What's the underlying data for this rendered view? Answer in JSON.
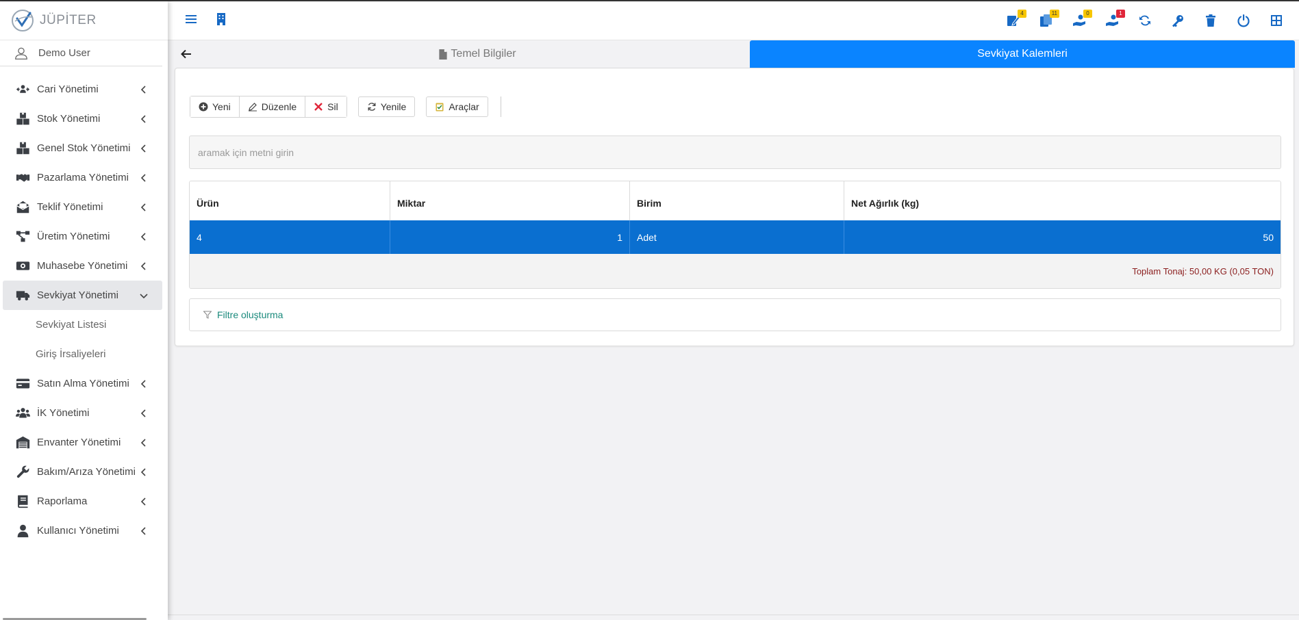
{
  "brand": {
    "name": "JÜPİTER"
  },
  "user": {
    "name": "Demo User"
  },
  "sidebar": {
    "items": [
      {
        "label": "Cari Yönetimi",
        "icon": "user-arrows-icon"
      },
      {
        "label": "Stok Yönetimi",
        "icon": "boxes-icon"
      },
      {
        "label": "Genel Stok Yönetimi",
        "icon": "boxes-icon"
      },
      {
        "label": "Pazarlama Yönetimi",
        "icon": "handshake-icon"
      },
      {
        "label": "Teklif Yönetimi",
        "icon": "envelope-open-icon"
      },
      {
        "label": "Üretim Yönetimi",
        "icon": "diagram-icon"
      },
      {
        "label": "Muhasebe Yönetimi",
        "icon": "money-bill-icon"
      },
      {
        "label": "Sevkiyat Yönetimi",
        "icon": "truck-icon",
        "expanded": true
      },
      {
        "label": "Satın Alma Yönetimi",
        "icon": "credit-card-icon"
      },
      {
        "label": "İK Yönetimi",
        "icon": "users-icon"
      },
      {
        "label": "Envanter Yönetimi",
        "icon": "warehouse-icon"
      },
      {
        "label": "Bakım/Arıza Yönetimi",
        "icon": "wrench-icon"
      },
      {
        "label": "Raporlama",
        "icon": "book-icon"
      },
      {
        "label": "Kullanıcı Yönetimi",
        "icon": "user-icon"
      }
    ],
    "sub_items": [
      {
        "label": "Sevkiyat Listesi"
      },
      {
        "label": "Giriş İrsaliyeleri"
      }
    ]
  },
  "header": {
    "badges": {
      "tasks": "4",
      "notes": "11",
      "hand1": "0",
      "hand2": "1"
    }
  },
  "tabs": [
    {
      "label": "Temel Bilgiler",
      "active": false
    },
    {
      "label": "Sevkiyat Kalemleri",
      "active": true
    }
  ],
  "toolbar": {
    "new_label": "Yeni",
    "edit_label": "Düzenle",
    "delete_label": "Sil",
    "refresh_label": "Yenile",
    "tools_label": "Araçlar"
  },
  "search": {
    "placeholder": "aramak için metni girin"
  },
  "grid": {
    "columns": [
      "Ürün",
      "Miktar",
      "Birim",
      "Net Ağırlık (kg)"
    ],
    "rows": [
      {
        "urun": "4",
        "miktar": "1",
        "birim": "Adet",
        "net_agirlik": "50"
      }
    ],
    "total_label": "Toplam Tonaj: 50,00 KG (0,05 TON)"
  },
  "filter": {
    "label": "Filtre oluşturma"
  },
  "colors": {
    "accent": "#0a84ff",
    "selected_row": "#0a6fd0",
    "header_icon": "#1769c4",
    "total_text": "#8b1e1e",
    "filter_text": "#1a8a7c"
  }
}
